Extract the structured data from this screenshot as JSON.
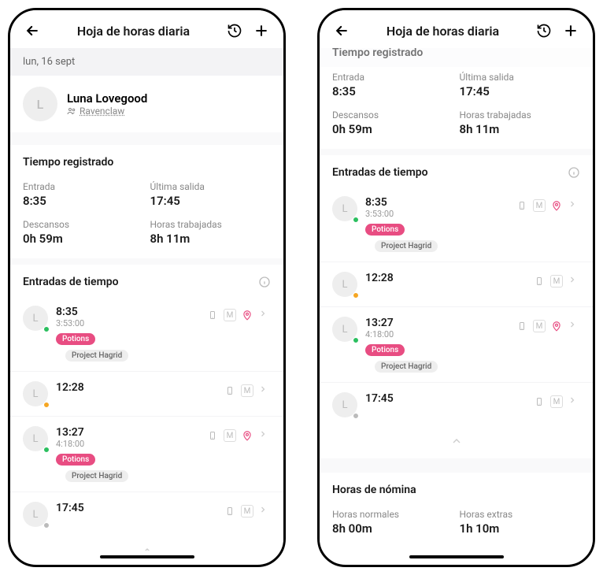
{
  "header": {
    "title": "Hoja de horas diaria"
  },
  "date": "lun, 16 sept",
  "profile": {
    "initial": "L",
    "name": "Luna Lovegood",
    "dept": "Ravenclaw"
  },
  "registered": {
    "title": "Tiempo registrado",
    "entry_label": "Entrada",
    "entry_value": "8:35",
    "exit_label": "Última salida",
    "exit_value": "17:45",
    "breaks_label": "Descansos",
    "breaks_value": "0h 59m",
    "worked_label": "Horas trabajadas",
    "worked_value": "8h 11m"
  },
  "entries_title": "Entradas de tiempo",
  "entries": [
    {
      "initial": "L",
      "time": "8:35",
      "duration": "3:53:00",
      "status": "green",
      "tag1": "Potions",
      "tag2": "Project Hagrid",
      "has_loc": true
    },
    {
      "initial": "L",
      "time": "12:28",
      "duration": "",
      "status": "orange",
      "tag1": "",
      "tag2": "",
      "has_loc": false
    },
    {
      "initial": "L",
      "time": "13:27",
      "duration": "4:18:00",
      "status": "green",
      "tag1": "Potions",
      "tag2": "Project Hagrid",
      "has_loc": true
    },
    {
      "initial": "L",
      "time": "17:45",
      "duration": "",
      "status": "gray",
      "tag1": "",
      "tag2": "",
      "has_loc": false
    }
  ],
  "payroll": {
    "title": "Horas de nómina",
    "normal_label": "Horas normales",
    "normal_value": "8h 00m",
    "extra_label": "Horas extras",
    "extra_value": "1h 10m"
  }
}
